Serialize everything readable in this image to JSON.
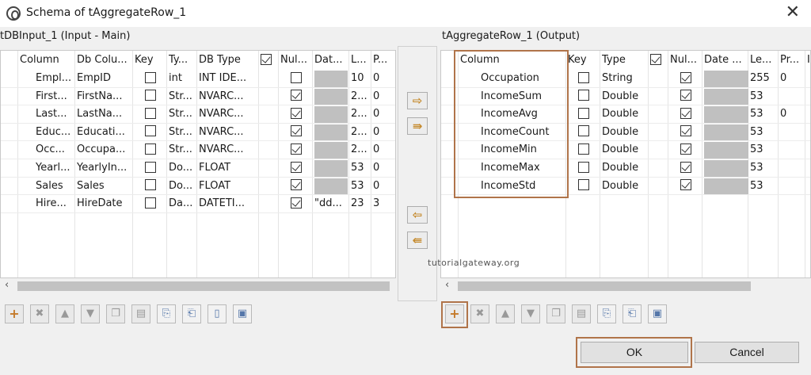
{
  "window": {
    "title": "Schema of tAggregateRow_1",
    "close_glyph": "✕"
  },
  "left": {
    "label": "tDBInput_1 (Input - Main)",
    "columns": [
      "Column",
      "Db Colu...",
      "Key",
      "Ty...",
      "DB Type",
      "",
      "Nul...",
      "Dat...",
      "L...",
      "P..."
    ],
    "rows": [
      {
        "column": "Empl...",
        "db": "EmpID",
        "key": false,
        "type": "int",
        "dbtype": "INT IDE...",
        "nullable": false,
        "date": "",
        "len": "10",
        "prec": "0"
      },
      {
        "column": "First...",
        "db": "FirstNa...",
        "key": false,
        "type": "Str...",
        "dbtype": "NVARC...",
        "nullable": true,
        "date": "",
        "len": "2...",
        "prec": "0"
      },
      {
        "column": "Last...",
        "db": "LastNa...",
        "key": false,
        "type": "Str...",
        "dbtype": "NVARC...",
        "nullable": true,
        "date": "",
        "len": "2...",
        "prec": "0"
      },
      {
        "column": "Educ...",
        "db": "Educati...",
        "key": false,
        "type": "Str...",
        "dbtype": "NVARC...",
        "nullable": true,
        "date": "",
        "len": "2...",
        "prec": "0"
      },
      {
        "column": "Occ...",
        "db": "Occupa...",
        "key": false,
        "type": "Str...",
        "dbtype": "NVARC...",
        "nullable": true,
        "date": "",
        "len": "2...",
        "prec": "0"
      },
      {
        "column": "Yearl...",
        "db": "YearlyIn...",
        "key": false,
        "type": "Do...",
        "dbtype": "FLOAT",
        "nullable": true,
        "date": "",
        "len": "53",
        "prec": "0"
      },
      {
        "column": "Sales",
        "db": "Sales",
        "key": false,
        "type": "Do...",
        "dbtype": "FLOAT",
        "nullable": true,
        "date": "",
        "len": "53",
        "prec": "0"
      },
      {
        "column": "Hire...",
        "db": "HireDate",
        "key": false,
        "type": "Da...",
        "dbtype": "DATETI...",
        "nullable": true,
        "date": "\"dd...",
        "len": "23",
        "prec": "3"
      }
    ]
  },
  "right": {
    "label": "tAggregateRow_1 (Output)",
    "columns": [
      "Column",
      "Key",
      "Type",
      "",
      "Nul...",
      "Date ...",
      "Le...",
      "Pr...",
      "I"
    ],
    "rows": [
      {
        "column": "Occupation",
        "key": false,
        "type": "String",
        "nullable": true,
        "len": "255",
        "prec": "0"
      },
      {
        "column": "IncomeSum",
        "key": false,
        "type": "Double",
        "nullable": true,
        "len": "53",
        "prec": ""
      },
      {
        "column": "IncomeAvg",
        "key": false,
        "type": "Double",
        "nullable": true,
        "len": "53",
        "prec": "0"
      },
      {
        "column": "IncomeCount",
        "key": false,
        "type": "Double",
        "nullable": true,
        "len": "53",
        "prec": ""
      },
      {
        "column": "IncomeMin",
        "key": false,
        "type": "Double",
        "nullable": true,
        "len": "53",
        "prec": ""
      },
      {
        "column": "IncomeMax",
        "key": false,
        "type": "Double",
        "nullable": true,
        "len": "53",
        "prec": ""
      },
      {
        "column": "IncomeStd",
        "key": false,
        "type": "Double",
        "nullable": true,
        "len": "53",
        "prec": ""
      }
    ]
  },
  "middle": {
    "copy_right": "⇨",
    "copy_all_right": "⇛",
    "copy_left": "⇦",
    "copy_all_left": "⇚"
  },
  "toolbar_glyphs": {
    "add": "+",
    "remove": "✖",
    "up": "▲",
    "down": "▼",
    "copy": "❐",
    "paste": "▤",
    "import": "⎘",
    "export": "⎗",
    "reset": "▯",
    "save": "▣"
  },
  "scroll": {
    "left_arrow": "‹",
    "right_arrow": "›"
  },
  "watermark": "tutorialgateway.org",
  "buttons": {
    "ok": "OK",
    "cancel": "Cancel"
  },
  "colors": {
    "highlight": "#b0744a",
    "accent_arrow": "#c58a2c"
  }
}
